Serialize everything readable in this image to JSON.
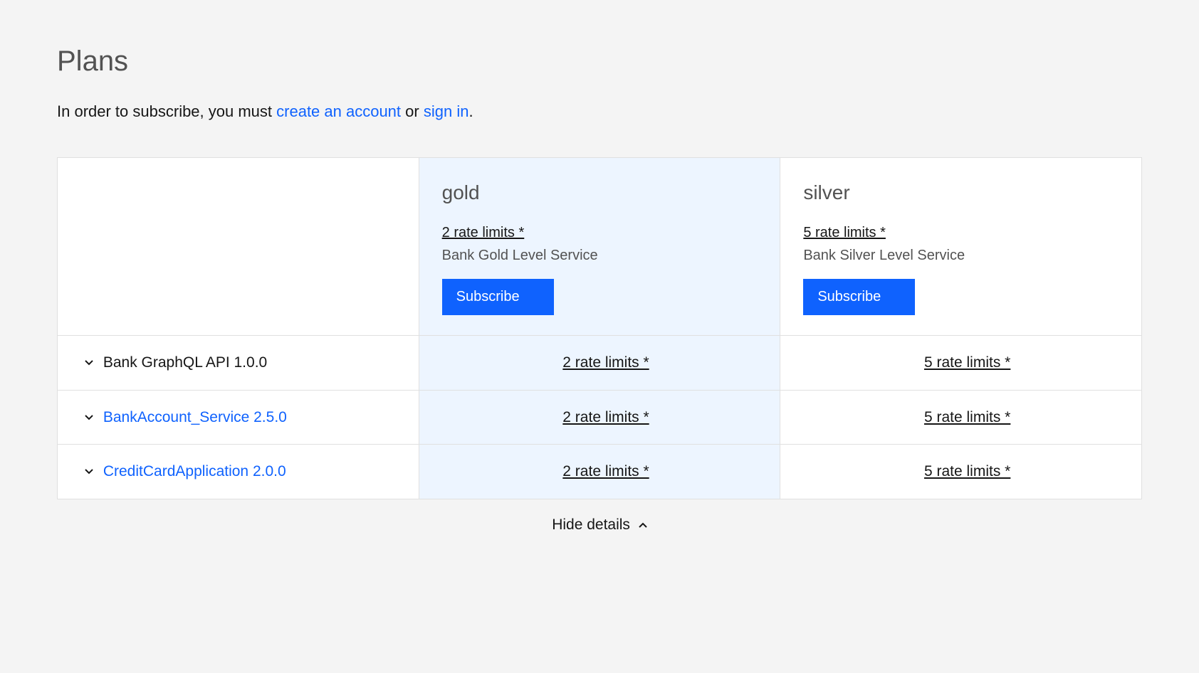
{
  "page": {
    "title": "Plans",
    "intro_prefix": "In order to subscribe, you must ",
    "create_account_link": "create an account",
    "intro_or": " or ",
    "sign_in_link": "sign in",
    "intro_suffix": "."
  },
  "plans": {
    "gold": {
      "name": "gold",
      "rate_limits": "2 rate limits *",
      "description": "Bank Gold Level Service",
      "subscribe_label": "Subscribe"
    },
    "silver": {
      "name": "silver",
      "rate_limits": "5 rate limits *",
      "description": "Bank Silver Level Service",
      "subscribe_label": "Subscribe"
    }
  },
  "apis": [
    {
      "name": "Bank GraphQL API 1.0.0",
      "link": false,
      "gold_rate": "2 rate limits *",
      "silver_rate": "5 rate limits *"
    },
    {
      "name": "BankAccount_Service 2.5.0",
      "link": true,
      "gold_rate": "2 rate limits *",
      "silver_rate": "5 rate limits *"
    },
    {
      "name": "CreditCardApplication 2.0.0",
      "link": true,
      "gold_rate": "2 rate limits *",
      "silver_rate": "5 rate limits *"
    }
  ],
  "footer": {
    "hide_details": "Hide details"
  }
}
